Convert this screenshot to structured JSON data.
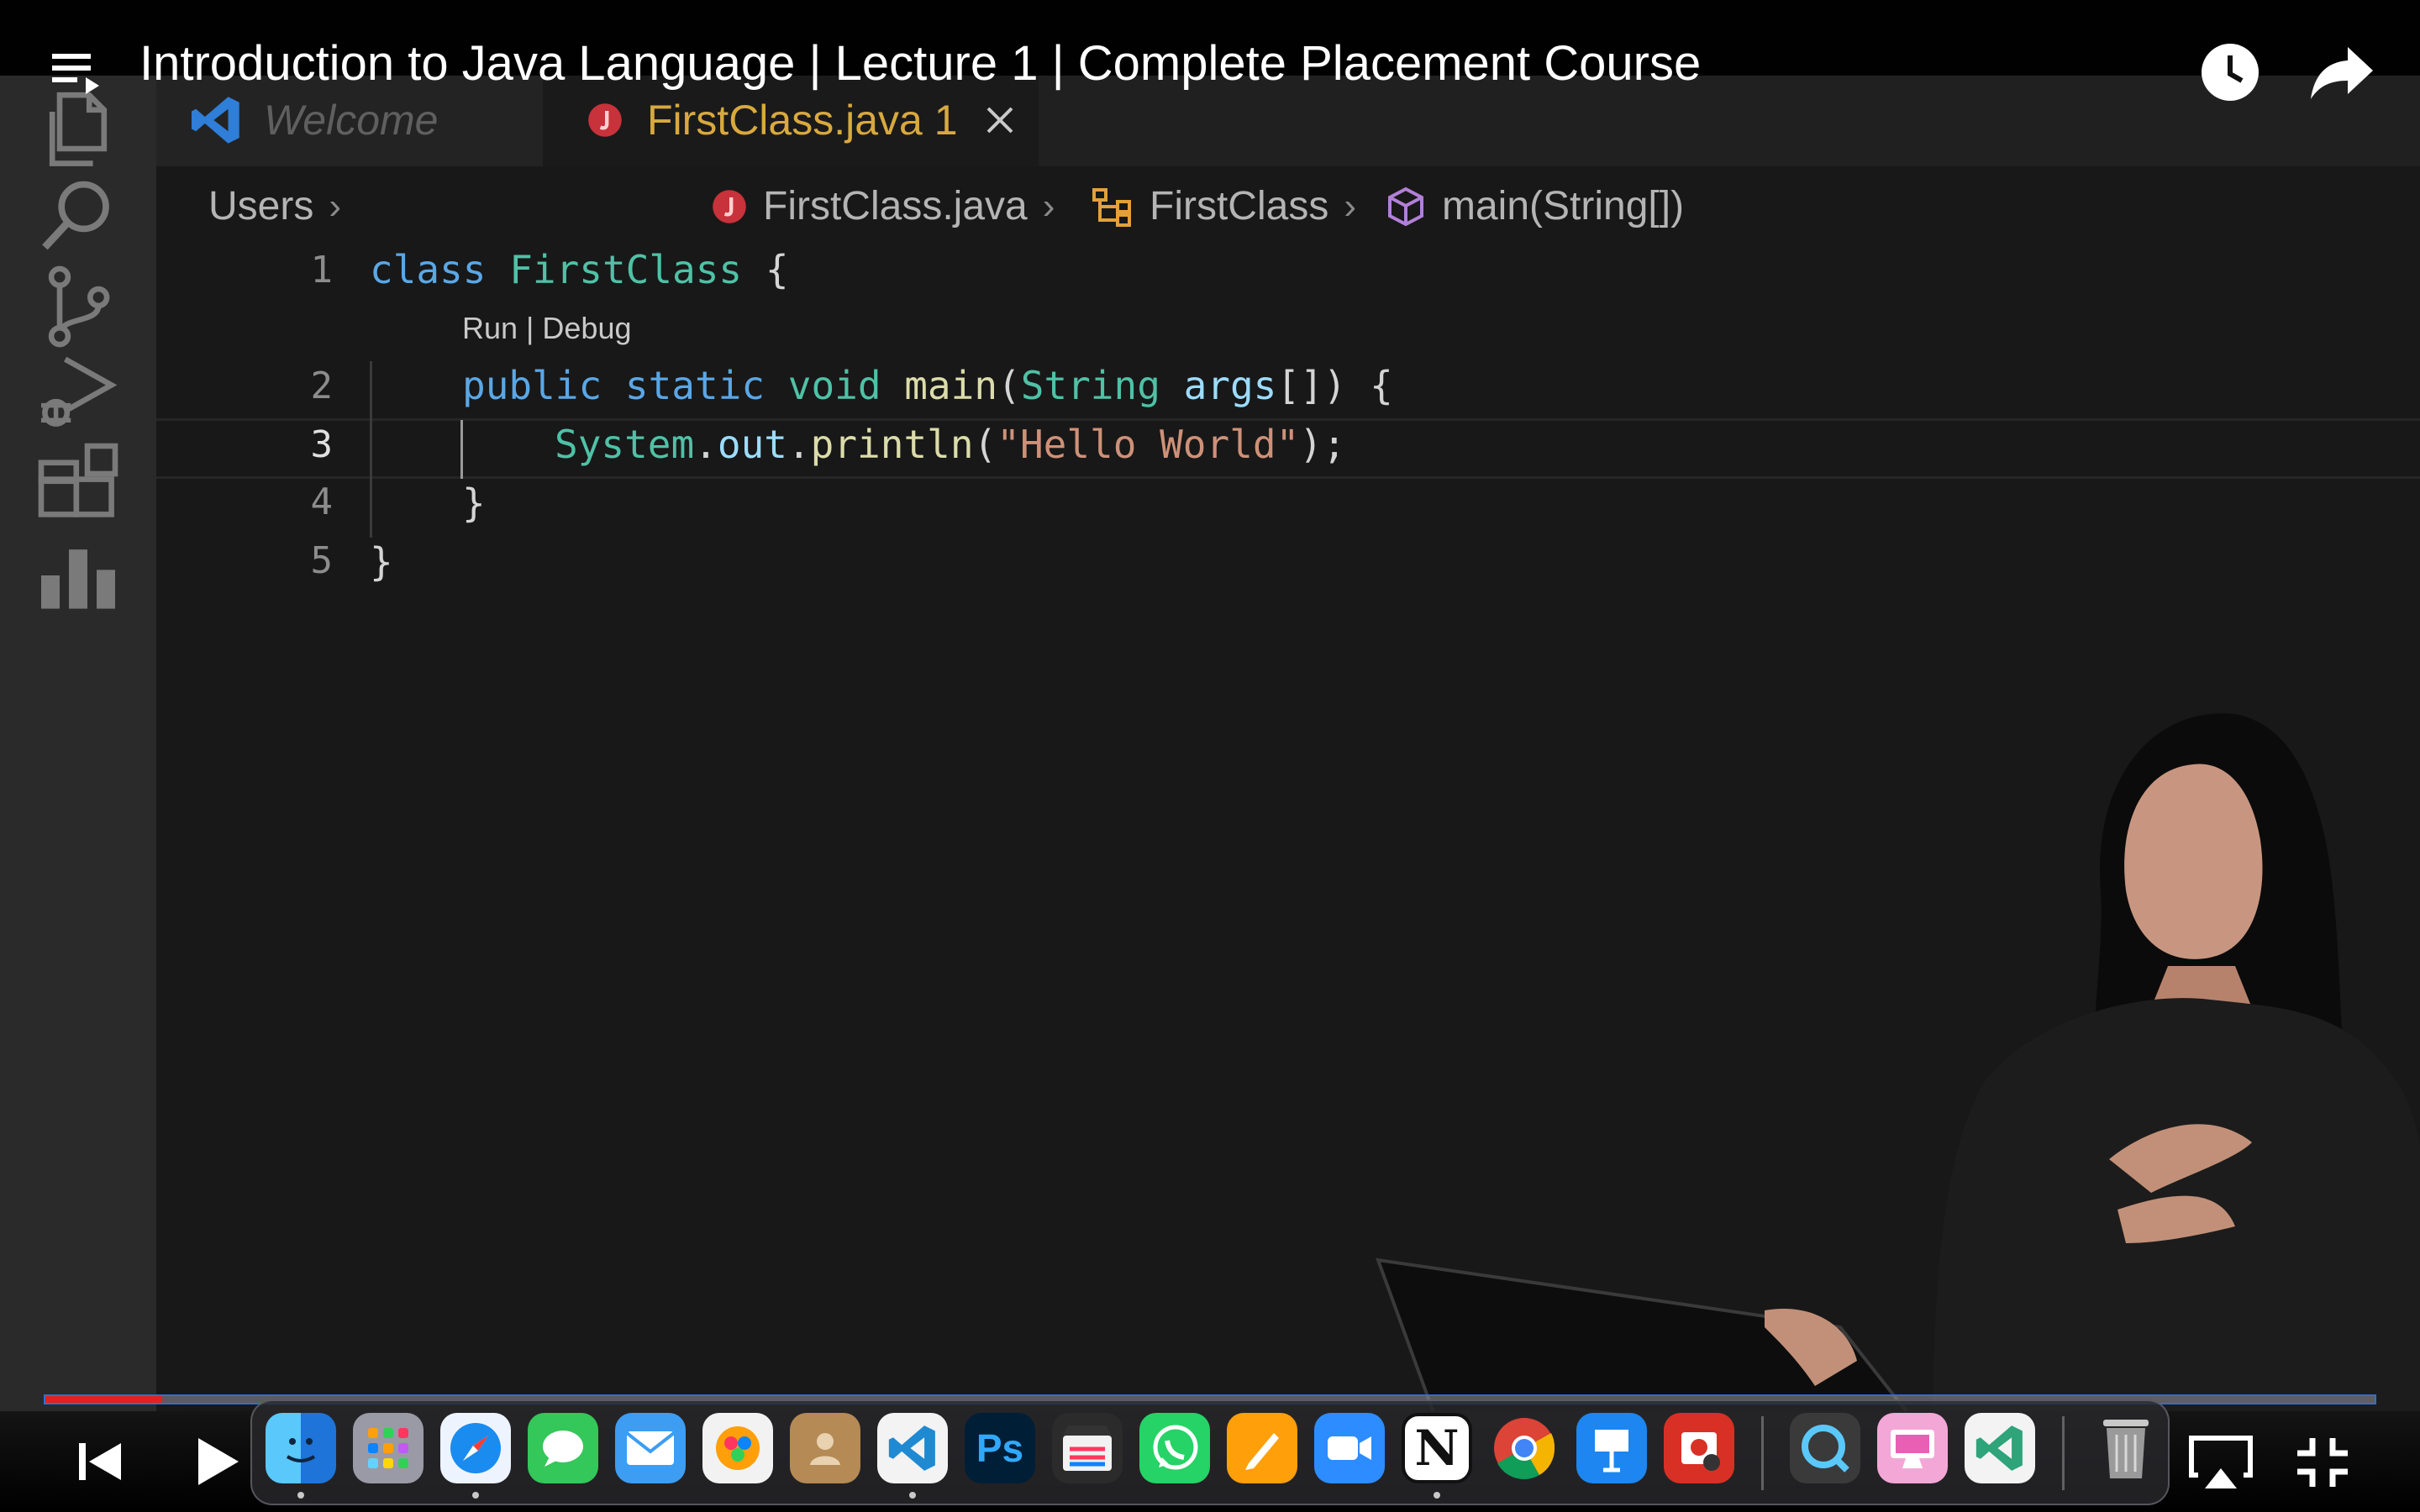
{
  "video": {
    "title": "Introduction to Java Language | Lecture 1 | Complete Placement Course",
    "progress": 0.05
  },
  "editor": {
    "tabs": [
      {
        "label": "Welcome"
      },
      {
        "label": "FirstClass.java 1"
      }
    ],
    "breadcrumb": {
      "folder": "Users",
      "file": "FirstClass.java",
      "class": "FirstClass",
      "method": "main(String[])"
    },
    "codelens": "Run | Debug",
    "line_numbers": [
      "1",
      "2",
      "3",
      "4",
      "5"
    ],
    "code": {
      "l1_kw": "class",
      "l1_name": "FirstClass",
      "l1_brace": "{",
      "l2_public": "public",
      "l2_static": "static",
      "l2_void": "void",
      "l2_main": "main",
      "l2_open": "(",
      "l2_type": "String",
      "l2_args": "args",
      "l2_rest": "[]) {",
      "l3_system": "System",
      "l3_dot1": ".",
      "l3_out": "out",
      "l3_dot2": ".",
      "l3_println": "println",
      "l3_open": "(",
      "l3_str": "\"Hello World\"",
      "l3_close": ");",
      "l4": "}",
      "l5": "}"
    }
  },
  "dock_apps": [
    "Finder",
    "Launchpad",
    "Safari",
    "Messages",
    "Mail",
    "Pixelmator",
    "Contacts",
    "Visual Studio Code",
    "Photoshop",
    "Final Cut Pro",
    "WhatsApp",
    "Pages",
    "Zoom",
    "Notion",
    "Chrome",
    "Keynote",
    "Photo Booth",
    "QuickTime",
    "CleanMyMac",
    "Visual Studio Code",
    "Trash"
  ],
  "dock_labels": {
    "photoshop": "Ps",
    "notion": "N"
  },
  "colors": {
    "progress": "#e52020",
    "keyword": "#5aa7e6",
    "type": "#4fc1a6",
    "string": "#ce9178",
    "tab_active": "#d8a93e"
  }
}
